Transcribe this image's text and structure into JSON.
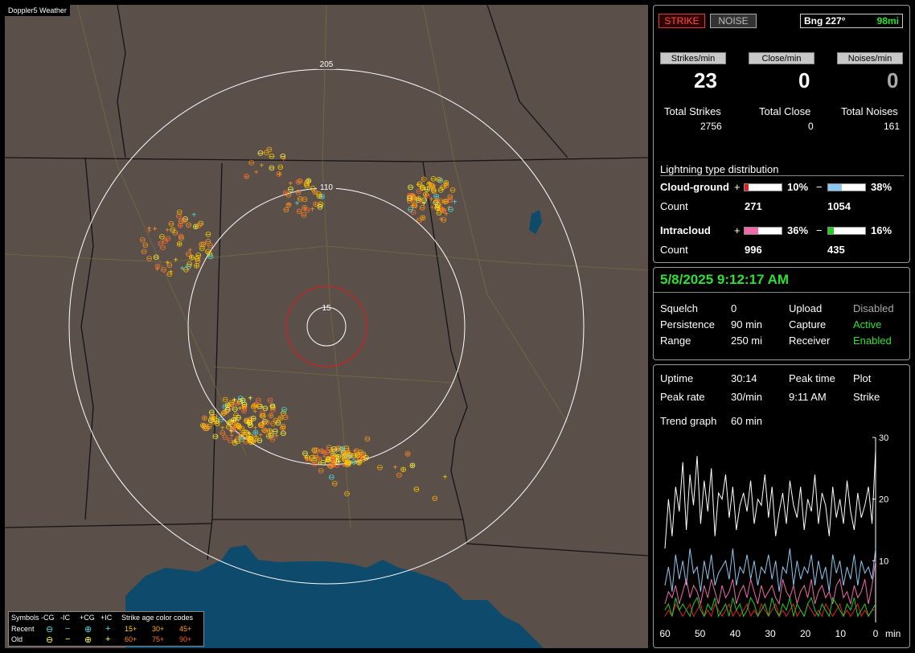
{
  "map": {
    "title": "Doppler5 Weather",
    "range_labels": [
      "15",
      "110",
      "205"
    ],
    "colors": {
      "land": "#5b4f49",
      "water": "#0d4a6b",
      "border": "#111111",
      "roads": "#7a7a40",
      "rings": "#ffffff",
      "inner_ring": "#cc2222"
    }
  },
  "legend": {
    "symbols_label": "Symbols",
    "col_headers": [
      "-CG",
      "-IC",
      "+CG",
      "+IC"
    ],
    "rows": [
      "Recent",
      "Old"
    ],
    "recent_symbols": [
      "⊖",
      "−",
      "⊕",
      "+"
    ],
    "old_symbols": [
      "⊖",
      "−",
      "⊕",
      "+"
    ],
    "age_title": "Strike age color codes",
    "recent_ages": [
      "15+",
      "30+",
      "45+"
    ],
    "old_ages": [
      "60+",
      "75+",
      "90+"
    ]
  },
  "panel1": {
    "strike_btn": "STRIKE",
    "noise_btn": "NOISE",
    "bearing_label": "Bng 227°",
    "bearing_range": "98mi",
    "headers": [
      "Strikes/min",
      "Close/min",
      "Noises/min"
    ],
    "rates": [
      "23",
      "0",
      "0"
    ],
    "total_labels": [
      "Total Strikes",
      "Total Close",
      "Total Noises"
    ],
    "totals": [
      "2756",
      "0",
      "161"
    ],
    "dist_title": "Lightning type distribution",
    "cg_label": "Cloud-ground",
    "ic_label": "Intracloud",
    "count_label": "Count",
    "plus": "+",
    "minus": "−",
    "cg_pos_pct": "10%",
    "cg_neg_pct": "38%",
    "cg_pos_count": "271",
    "cg_neg_count": "1054",
    "ic_pos_pct": "36%",
    "ic_neg_pct": "16%",
    "ic_pos_count": "996",
    "ic_neg_count": "435",
    "bar_fill": {
      "cg_pos": 0.1,
      "cg_neg": 0.38,
      "ic_pos": 0.36,
      "ic_neg": 0.16
    },
    "bar_colors": {
      "cg_pos": "#e02020",
      "cg_neg": "#8ec8f0",
      "ic_pos": "#f06aa8",
      "ic_neg": "#22cc22"
    }
  },
  "panel2": {
    "datetime": "5/8/2025 9:12:17 AM",
    "squelch_label": "Squelch",
    "squelch": "0",
    "persistence_label": "Persistence",
    "persistence": "90 min",
    "range_label": "Range",
    "range": "250 mi",
    "upload_label": "Upload",
    "upload": "Disabled",
    "capture_label": "Capture",
    "capture": "Active",
    "receiver_label": "Receiver",
    "receiver": "Enabled"
  },
  "panel3": {
    "uptime_label": "Uptime",
    "uptime": "30:14",
    "peak_time_label": "Peak time",
    "peak_time": "9:11 AM",
    "plot_label": "Plot",
    "plot": "Strike",
    "peak_rate_label": "Peak rate",
    "peak_rate": "30/min",
    "trend_label": "Trend graph",
    "trend": "60 min"
  },
  "chart_data": {
    "type": "line",
    "x_ticks": [
      "60",
      "50",
      "40",
      "30",
      "20",
      "10",
      "0"
    ],
    "x_unit": "min",
    "y_ticks": [
      "30",
      "20",
      "10"
    ],
    "ylim": [
      0,
      30
    ],
    "xlim": [
      60,
      0
    ],
    "series": [
      {
        "color": "#ffffff",
        "values": [
          12,
          20,
          14,
          22,
          18,
          26,
          15,
          24,
          19,
          27,
          16,
          23,
          18,
          25,
          14,
          21,
          20,
          24,
          17,
          22,
          15,
          19,
          21,
          18,
          23,
          16,
          20,
          19,
          24,
          17,
          22,
          14,
          18,
          21,
          16,
          23,
          19,
          17,
          22,
          15,
          20,
          18,
          24,
          16,
          21,
          19,
          14,
          22,
          17,
          20,
          16,
          23,
          18,
          15,
          21,
          17,
          19,
          22,
          16,
          28
        ]
      },
      {
        "color": "#8ec8f0",
        "values": [
          6,
          9,
          5,
          11,
          7,
          10,
          6,
          12,
          8,
          9,
          5,
          10,
          7,
          11,
          6,
          8,
          9,
          10,
          7,
          12,
          6,
          9,
          8,
          11,
          7,
          10,
          6,
          9,
          8,
          11,
          7,
          10,
          5,
          9,
          8,
          12,
          6,
          10,
          7,
          9,
          8,
          11,
          6,
          10,
          7,
          9,
          5,
          11,
          8,
          10,
          6,
          9,
          7,
          11,
          6,
          10,
          8,
          9,
          7,
          12
        ]
      },
      {
        "color": "#f06aa8",
        "values": [
          3,
          5,
          4,
          6,
          3,
          5,
          7,
          4,
          6,
          5,
          3,
          6,
          4,
          7,
          5,
          3,
          6,
          4,
          5,
          7,
          3,
          5,
          6,
          4,
          7,
          5,
          3,
          6,
          4,
          5,
          6,
          4,
          3,
          7,
          5,
          4,
          6,
          3,
          5,
          6,
          4,
          7,
          3,
          5,
          6,
          4,
          5,
          3,
          6,
          7,
          4,
          5,
          3,
          6,
          4,
          5,
          7,
          3,
          6,
          10
        ]
      },
      {
        "color": "#e02020",
        "values": [
          1,
          2,
          1,
          3,
          2,
          1,
          2,
          3,
          1,
          2,
          3,
          1,
          2,
          1,
          3,
          2,
          1,
          2,
          3,
          1,
          2,
          1,
          2,
          3,
          1,
          2,
          1,
          3,
          2,
          1,
          2,
          3,
          1,
          2,
          1,
          2,
          3,
          1,
          2,
          1,
          3,
          2,
          1,
          2,
          1,
          3,
          2,
          1,
          2,
          3,
          1,
          2,
          1,
          2,
          3,
          1,
          2,
          1,
          2,
          2
        ]
      },
      {
        "color": "#22cc22",
        "values": [
          2,
          3,
          1,
          4,
          2,
          3,
          2,
          1,
          3,
          4,
          2,
          1,
          3,
          2,
          4,
          1,
          2,
          3,
          1,
          4,
          2,
          3,
          1,
          2,
          4,
          3,
          1,
          2,
          3,
          1,
          4,
          2,
          1,
          3,
          2,
          4,
          1,
          3,
          2,
          1,
          3,
          4,
          2,
          1,
          3,
          2,
          1,
          4,
          3,
          2,
          1,
          3,
          2,
          4,
          1,
          2,
          3,
          1,
          2,
          3
        ]
      }
    ]
  }
}
